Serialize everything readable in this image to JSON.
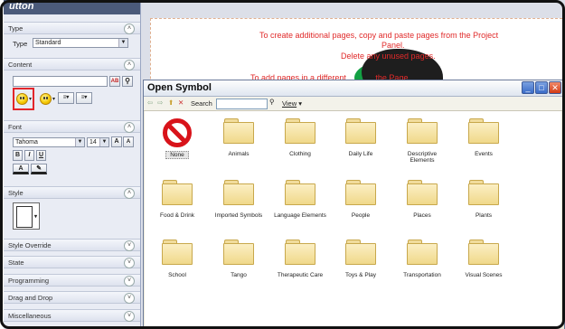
{
  "panel": {
    "title": "utton",
    "type_section": "Type",
    "type_label": "Type",
    "type_value": "Standard",
    "content_section": "Content",
    "ab_label": "AB",
    "font_section": "Font",
    "font_name": "Tahoma",
    "font_size": "14",
    "grow_label": "A",
    "bold": "B",
    "italic": "I",
    "underline": "U",
    "text_color_glyph": "A",
    "style_section": "Style",
    "collapsed_sections": [
      "Style Override",
      "State",
      "Programming",
      "Drag and Drop",
      "Miscellaneous"
    ]
  },
  "canvas": {
    "line1": "To create additional pages,  copy and paste pages from the Project",
    "line2": "Panel.",
    "line3": "Delete any unused pages.",
    "line4": "To add pages in a different ... ... ... the Page"
  },
  "dialog": {
    "title": "Open Symbol",
    "search_label": "Search",
    "search_value": "",
    "view_label": "View",
    "items": [
      "None",
      "Animals",
      "Clothing",
      "Daily Life",
      "Descriptive Elements",
      "Events",
      "Food & Drink",
      "Imported Symbols",
      "Language Elements",
      "People",
      "Places",
      "Plants",
      "School",
      "Tango",
      "Therapeutic Care",
      "Toys & Play",
      "Transportation",
      "Visual Scenes"
    ]
  }
}
